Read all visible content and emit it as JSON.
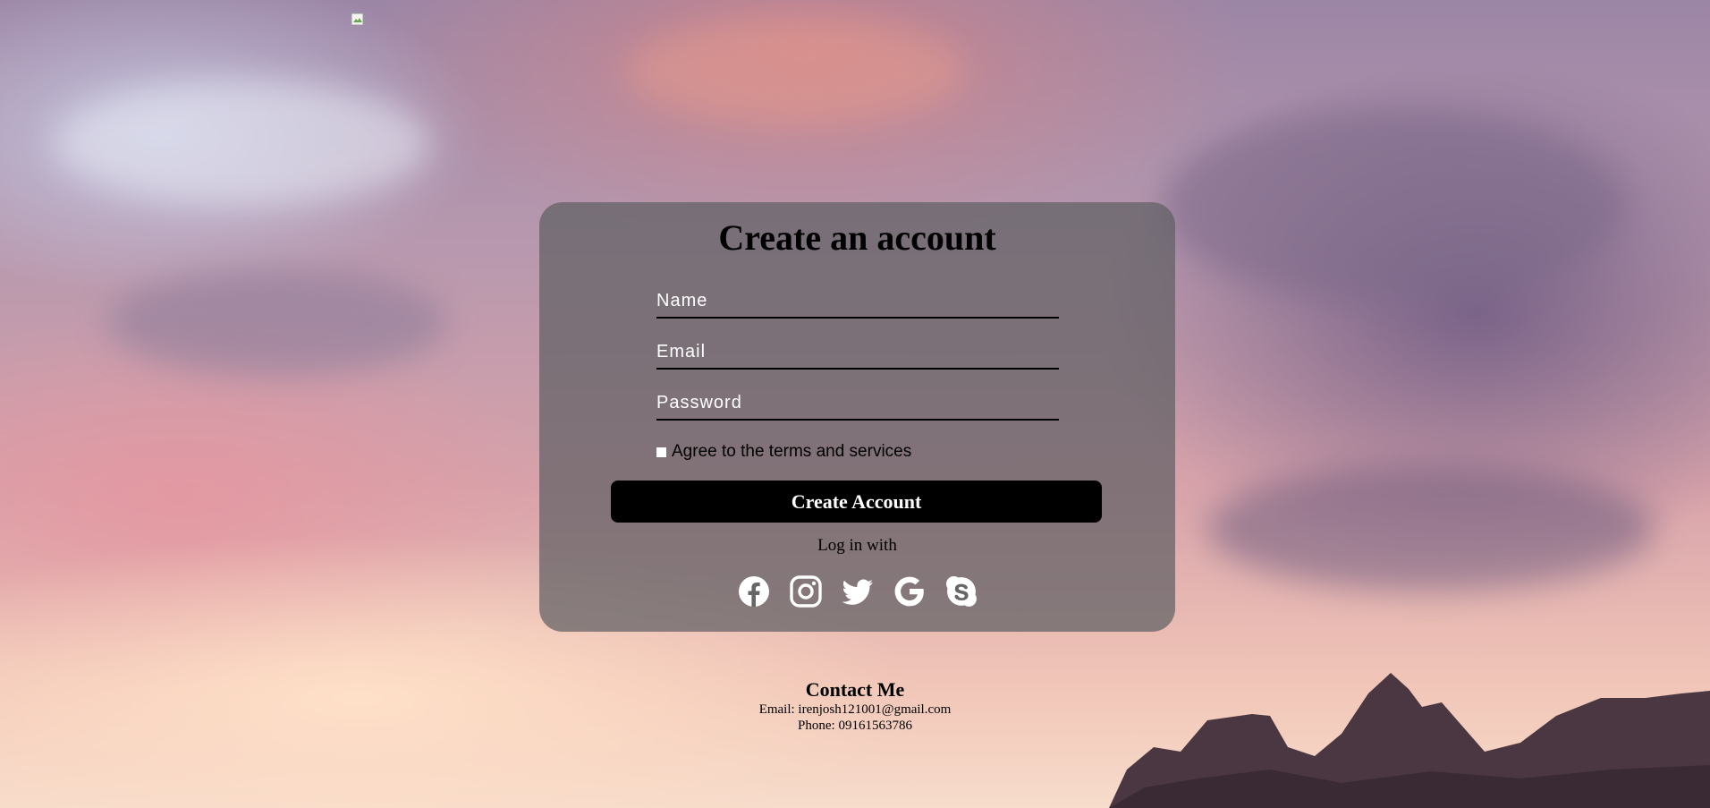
{
  "form": {
    "title": "Create an account",
    "name_placeholder": "Name",
    "email_placeholder": "Email",
    "password_placeholder": "Password",
    "terms_label": "Agree to the terms and services",
    "submit_label": "Create Account",
    "login_with_label": "Log in with"
  },
  "socials": [
    {
      "icon": "facebook-icon"
    },
    {
      "icon": "instagram-icon"
    },
    {
      "icon": "twitter-icon"
    },
    {
      "icon": "google-icon"
    },
    {
      "icon": "skype-icon"
    }
  ],
  "contact": {
    "heading": "Contact Me",
    "email": "Email: irenjosh121001@gmail.com",
    "phone": "Phone: 09161563786"
  },
  "colors": {
    "card_bg": "#5f5f64",
    "button_bg": "#000000",
    "text_light": "#ffffff"
  }
}
